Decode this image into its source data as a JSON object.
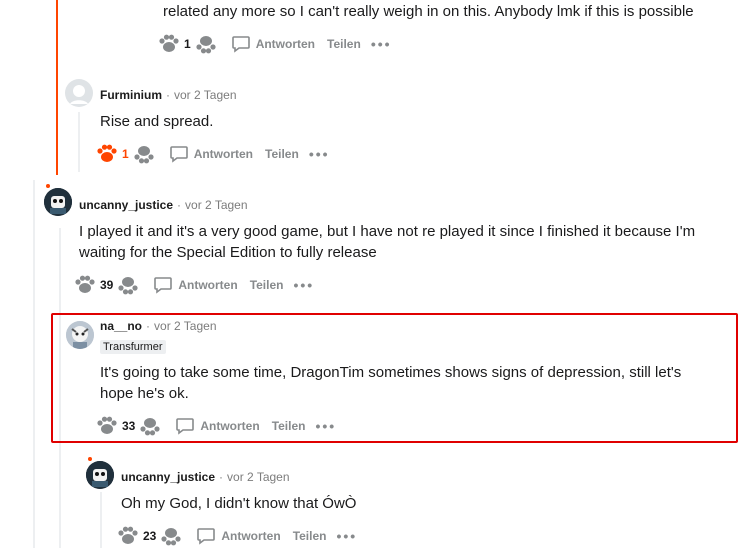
{
  "comments": [
    {
      "id": "c0",
      "text": "related any more so I can't really weigh in on this. Anybody lmk if this is possible",
      "votes": "1",
      "voted": false
    },
    {
      "id": "c1",
      "username": "Furminium",
      "time": "vor 2 Tagen",
      "text": "Rise and spread.",
      "votes": "1",
      "voted": true
    },
    {
      "id": "c2",
      "username": "uncanny_justice",
      "time": "vor 2 Tagen",
      "text": "I played it and it's a very good game, but I have not re played it since I finished it because I'm waiting for the Special Edition to fully release",
      "votes": "39",
      "voted": false
    },
    {
      "id": "c3",
      "username": "na__no",
      "time": "vor 2 Tagen",
      "flair": "Transfurmer",
      "text": "It's going to take some time, DragonTim sometimes shows signs of depression, still let's hope he's ok.",
      "votes": "33",
      "voted": false
    },
    {
      "id": "c4",
      "username": "uncanny_justice",
      "time": "vor 2 Tagen",
      "text": "Oh my God, I didn't know that ÓwÒ",
      "votes": "23",
      "voted": false
    }
  ],
  "labels": {
    "reply": "Antworten",
    "share": "Teilen",
    "more": "•••",
    "separator": "·"
  },
  "icons": {
    "upvote": "paw-upvote-icon",
    "downvote": "paw-downvote-icon",
    "reply": "comment-bubble-icon",
    "more": "more-options-icon"
  },
  "colors": {
    "upvoted": "#ff4500",
    "highlight_border": "#e00000",
    "meta": "#7c7c7c",
    "action": "#878a8c"
  }
}
